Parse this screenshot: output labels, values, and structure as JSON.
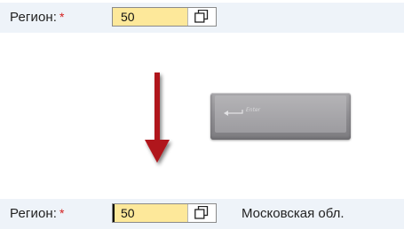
{
  "before": {
    "label": "Регион:",
    "required_mark": "*",
    "input_value": "50",
    "help_icon": "value-help-icon"
  },
  "key": {
    "label": "Enter",
    "icon": "enter-key-arrow-icon"
  },
  "after": {
    "label": "Регион:",
    "required_mark": "*",
    "input_value": "50",
    "help_icon": "value-help-icon",
    "description": "Московская обл."
  },
  "colors": {
    "row_background": "#eef3f9",
    "input_background": "#fde89a",
    "required": "#d42020",
    "arrow": "#b0141c"
  }
}
